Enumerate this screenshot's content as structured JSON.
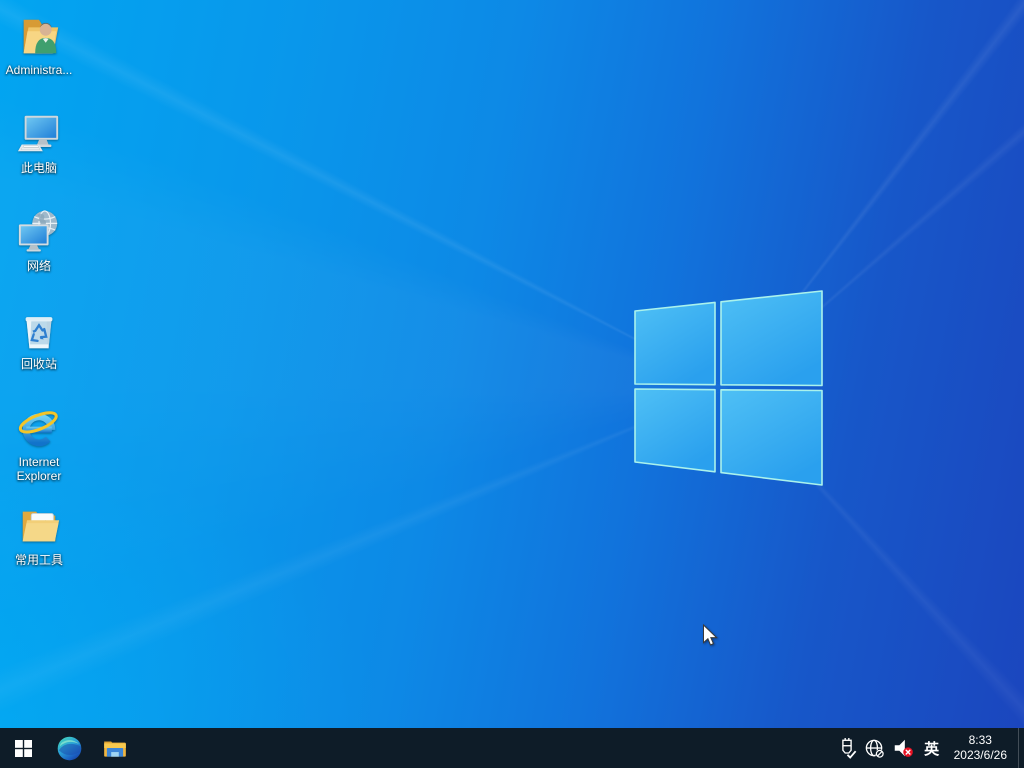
{
  "wallpaper": {
    "base_left_color": "#02a5f1",
    "base_right_color": "#1b46be",
    "logo_fill": "#3bb0f1",
    "logo_border": "#aaf2ec"
  },
  "desktop": {
    "icons": [
      {
        "name": "administrator-folder",
        "label": "Administra..."
      },
      {
        "name": "this-pc",
        "label": "此电脑"
      },
      {
        "name": "network",
        "label": "网络"
      },
      {
        "name": "recycle-bin",
        "label": "回收站"
      },
      {
        "name": "internet-explorer",
        "label": "Internet Explorer"
      },
      {
        "name": "common-tools",
        "label": "常用工具"
      }
    ]
  },
  "taskbar": {
    "background_color": "#0e1c28",
    "apps": [
      {
        "name": "start"
      },
      {
        "name": "microsoft-edge"
      },
      {
        "name": "file-explorer"
      }
    ],
    "tray": {
      "icons": [
        {
          "name": "usb-device"
        },
        {
          "name": "network-offline"
        },
        {
          "name": "volume-muted"
        }
      ],
      "input_method": "英",
      "clock": {
        "time": "8:33",
        "date": "2023/6/26"
      }
    }
  }
}
